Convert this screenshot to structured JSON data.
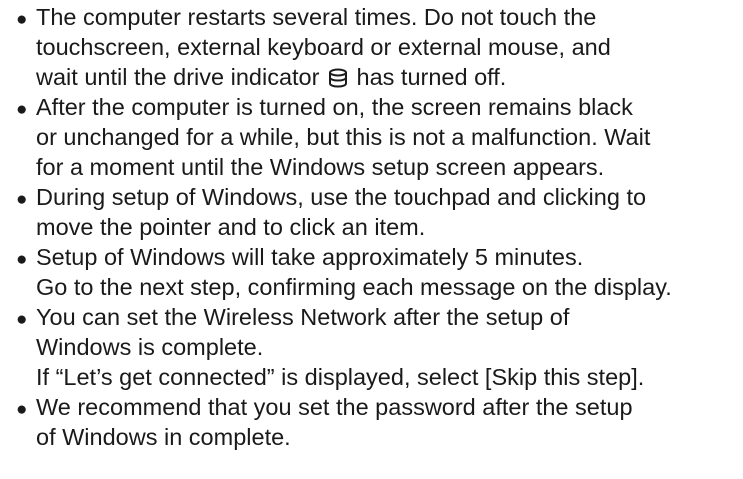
{
  "notes": {
    "bullet_symbol": "●",
    "items": [
      {
        "lines": [
          "The computer restarts several times. Do not touch the",
          "touchscreen, external keyboard or external mouse, and",
          "wait until the drive indicator",
          "has turned off."
        ]
      },
      {
        "lines": [
          "After the computer is turned on, the screen remains black",
          "or unchanged for a while, but this is not a malfunction. Wait",
          "for a moment until the Windows setup screen appears."
        ]
      },
      {
        "lines": [
          "During setup of Windows, use the touchpad and clicking to",
          "move the pointer and to click an item."
        ]
      },
      {
        "lines": [
          "Setup of Windows will take approximately 5 minutes.",
          "Go to the next step, confirming each message on the display."
        ]
      },
      {
        "lines": [
          "You can set the Wireless Network after the setup of",
          "Windows is complete.",
          "If “Let’s get connected” is displayed,  select [Skip this step]."
        ]
      },
      {
        "lines": [
          "We recommend that you set the password after the setup",
          "of Windows in complete."
        ]
      }
    ],
    "drive_indicator_icon": "drive-indicator-icon"
  }
}
